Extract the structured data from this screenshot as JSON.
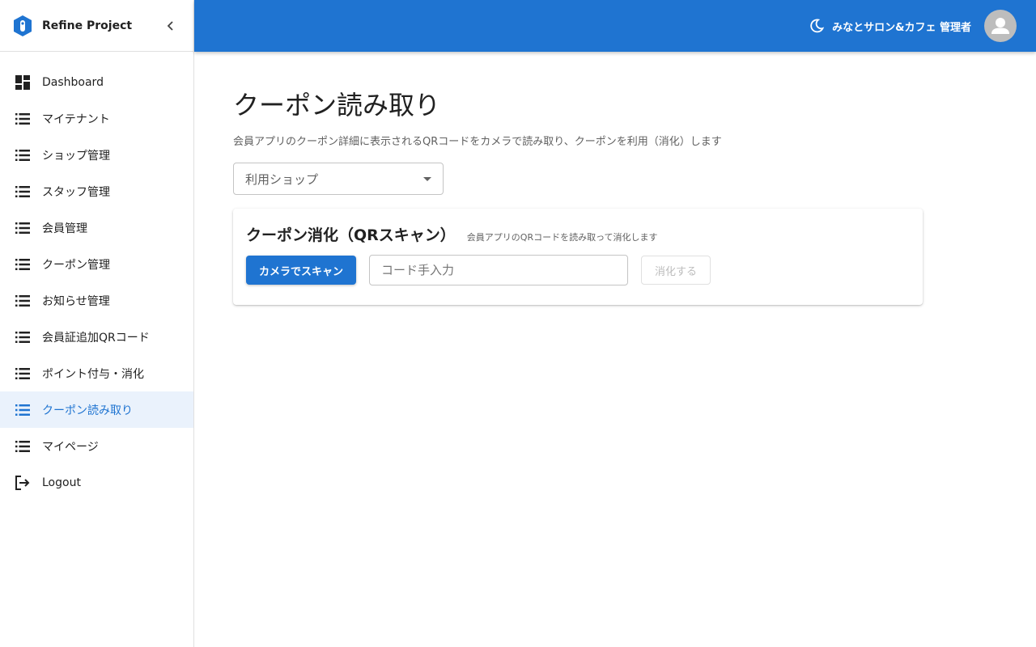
{
  "brand": {
    "name": "Refine Project"
  },
  "sidebar": {
    "items": [
      {
        "label": "Dashboard",
        "icon": "dashboard-icon",
        "active": false
      },
      {
        "label": "マイテナント",
        "icon": "list-icon",
        "active": false
      },
      {
        "label": "ショップ管理",
        "icon": "list-icon",
        "active": false
      },
      {
        "label": "スタッフ管理",
        "icon": "list-icon",
        "active": false
      },
      {
        "label": "会員管理",
        "icon": "list-icon",
        "active": false
      },
      {
        "label": "クーポン管理",
        "icon": "list-icon",
        "active": false
      },
      {
        "label": "お知らせ管理",
        "icon": "list-icon",
        "active": false
      },
      {
        "label": "会員証追加QRコード",
        "icon": "list-icon",
        "active": false
      },
      {
        "label": "ポイント付与・消化",
        "icon": "list-icon",
        "active": false
      },
      {
        "label": "クーポン読み取り",
        "icon": "list-icon",
        "active": true
      },
      {
        "label": "マイページ",
        "icon": "list-icon",
        "active": false
      },
      {
        "label": "Logout",
        "icon": "logout-icon",
        "active": false
      }
    ]
  },
  "topbar": {
    "user_label": "みなとサロン&カフェ 管理者",
    "theme_icon": "moon-icon",
    "avatar_icon": "person-icon"
  },
  "page": {
    "title": "クーポン読み取り",
    "description": "会員アプリのクーポン詳細に表示されるQRコードをカメラで読み取り、クーポンを利用（消化）します",
    "shop_select_label": "利用ショップ"
  },
  "card": {
    "title": "クーポン消化（QRスキャン）",
    "subtitle": "会員アプリのQRコードを読み取って消化します",
    "scan_button": "カメラでスキャン",
    "code_placeholder": "コード手入力",
    "code_value": "",
    "consume_button": "消化する"
  },
  "colors": {
    "primary": "#1f74d1",
    "active_bg": "#eaf2fc",
    "text": "#212121",
    "muted": "#616161"
  }
}
